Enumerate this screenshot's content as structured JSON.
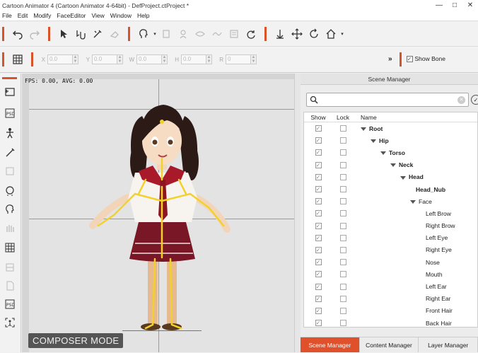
{
  "window": {
    "title": "Cartoon Animator 4  (Cartoon Animator 4-64bit) - DefProject.ctProject *",
    "minimize": "—",
    "maximize": "□",
    "close": "✕"
  },
  "menu": [
    "File",
    "Edit",
    "Modify",
    "FaceEditor",
    "View",
    "Window",
    "Help"
  ],
  "transform": {
    "x_label": "X",
    "x_value": "0.0",
    "y_label": "Y",
    "y_value": "0.0",
    "w_label": "W",
    "w_value": "0.0",
    "h_label": "H",
    "h_value": "0.0",
    "r_label": "R",
    "r_value": "0"
  },
  "show_bone": {
    "label": "Show Bone",
    "checked": true
  },
  "more_glyph": "»",
  "viewport": {
    "fps_text": "FPS: 0.00, AVG: 0.00",
    "mode_label": "COMPOSER MODE"
  },
  "scene_manager": {
    "title": "Scene Manager",
    "search_placeholder": "",
    "headers": {
      "show": "Show",
      "lock": "Lock",
      "name": "Name"
    },
    "rows": [
      {
        "name": "Root",
        "depth": 0,
        "expanded": true,
        "bold": true
      },
      {
        "name": "Hip",
        "depth": 1,
        "expanded": true,
        "bold": true
      },
      {
        "name": "Torso",
        "depth": 2,
        "expanded": true,
        "bold": true
      },
      {
        "name": "Neck",
        "depth": 3,
        "expanded": true,
        "bold": true
      },
      {
        "name": "Head",
        "depth": 4,
        "expanded": true,
        "bold": true
      },
      {
        "name": "Head_Nub",
        "depth": 5,
        "expanded": false,
        "bold": true
      },
      {
        "name": "Face",
        "depth": 5,
        "expanded": true,
        "bold": false
      },
      {
        "name": "Left Brow",
        "depth": 6,
        "expanded": false,
        "bold": false
      },
      {
        "name": "Right Brow",
        "depth": 6,
        "expanded": false,
        "bold": false
      },
      {
        "name": "Left Eye",
        "depth": 6,
        "expanded": false,
        "bold": false
      },
      {
        "name": "Right Eye",
        "depth": 6,
        "expanded": false,
        "bold": false
      },
      {
        "name": "Nose",
        "depth": 6,
        "expanded": false,
        "bold": false
      },
      {
        "name": "Mouth",
        "depth": 6,
        "expanded": false,
        "bold": false
      },
      {
        "name": "Left Ear",
        "depth": 6,
        "expanded": false,
        "bold": false
      },
      {
        "name": "Right Ear",
        "depth": 6,
        "expanded": false,
        "bold": false
      },
      {
        "name": "Front Hair",
        "depth": 6,
        "expanded": false,
        "bold": false
      },
      {
        "name": "Back Hair",
        "depth": 6,
        "expanded": false,
        "bold": false
      }
    ]
  },
  "tabs": [
    {
      "label": "Scene Manager",
      "active": true
    },
    {
      "label": "Content Manager",
      "active": false
    },
    {
      "label": "Layer Manager",
      "active": false
    }
  ],
  "colors": {
    "accent": "#e0502a",
    "bone": "#f2d22a"
  }
}
